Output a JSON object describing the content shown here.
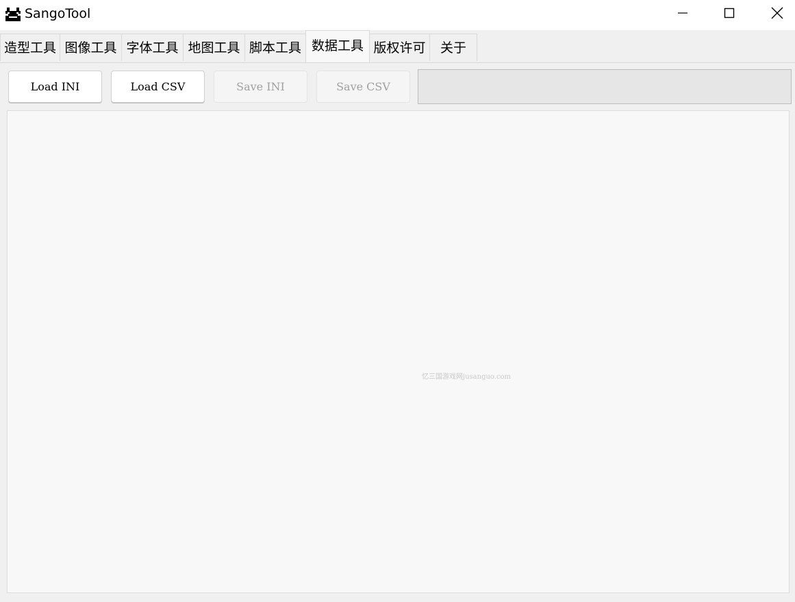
{
  "window": {
    "title": "SangoTool",
    "icon": "app-icon"
  },
  "controls": {
    "minimize_icon": "minimize-icon",
    "maximize_icon": "maximize-icon",
    "close_icon": "close-icon"
  },
  "tabs": [
    {
      "label": "造型工具",
      "active": false
    },
    {
      "label": "图像工具",
      "active": false
    },
    {
      "label": "字体工具",
      "active": false
    },
    {
      "label": "地图工具",
      "active": false
    },
    {
      "label": "脚本工具",
      "active": false
    },
    {
      "label": "数据工具",
      "active": true
    },
    {
      "label": "版权许可",
      "active": false
    },
    {
      "label": "关于",
      "active": false
    }
  ],
  "toolbar": {
    "load_ini_label": "Load INI",
    "load_csv_label": "Load CSV",
    "save_ini_label": "Save INI",
    "save_csv_label": "Save CSV",
    "save_ini_enabled": false,
    "save_csv_enabled": false,
    "progress": 0
  },
  "content": {
    "watermark": "忆三国游戏网jusanguo.com"
  },
  "colors": {
    "titlebar": "#ffffff",
    "window_bg": "#f0f0f0",
    "content_bg": "#f8f8f8",
    "progress_bg": "#e6e6e6",
    "disabled_text": "#a0a0a0"
  }
}
